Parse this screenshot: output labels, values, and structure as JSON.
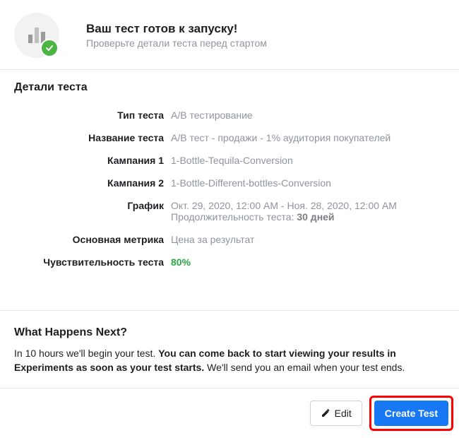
{
  "header": {
    "title": "Ваш тест готов к запуску!",
    "subtitle": "Проверьте детали теста перед стартом"
  },
  "details": {
    "section_title": "Детали теста",
    "rows": {
      "type": {
        "label": "Тип теста",
        "value": "A/B тестирование"
      },
      "name": {
        "label": "Название теста",
        "value": "A/B тест - продажи - 1% аудитория покупателей"
      },
      "campaign1": {
        "label": "Кампания 1",
        "value": "1-Bottle-Tequila-Conversion"
      },
      "campaign2": {
        "label": "Кампания 2",
        "value": "1-Bottle-Different-bottles-Conversion"
      },
      "schedule": {
        "label": "График",
        "range": "Окт. 29, 2020, 12:00 AM - Ноя. 28, 2020, 12:00 AM",
        "duration_prefix": "Продолжительность теста: ",
        "duration_value": "30 дней"
      },
      "metric": {
        "label": "Основная метрика",
        "value": "Цена за результат"
      },
      "sensitivity": {
        "label": "Чувствительность теста",
        "value": "80%"
      }
    }
  },
  "next": {
    "title": "What Happens Next?",
    "pre": "In 10 hours we'll begin your test. ",
    "bold": "You can come back to start viewing your results in Experiments as soon as your test starts.",
    "post": " We'll send you an email when your test ends."
  },
  "footer": {
    "edit_label": "Edit",
    "create_label": "Create Test"
  },
  "colors": {
    "success_badge": "#4bb543",
    "sensitivity_green": "#2aa841",
    "primary_button": "#1877f2",
    "highlight_border": "#ff0000"
  }
}
